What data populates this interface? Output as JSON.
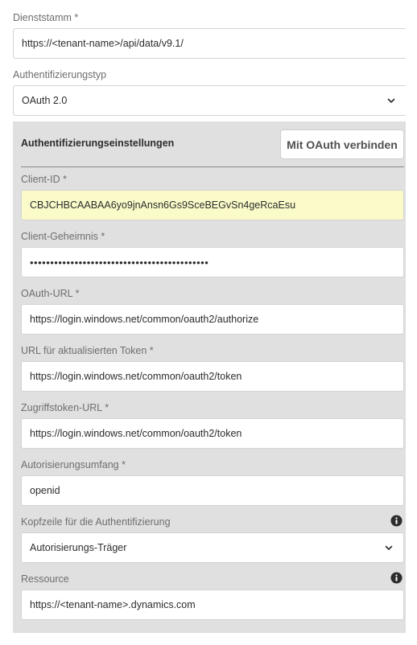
{
  "service_root": {
    "label": "Dienststamm *",
    "value": "https://<tenant-name>/api/data/v9.1/"
  },
  "auth_type": {
    "label": "Authentifizierungstyp",
    "selected": "OAuth 2.0"
  },
  "auth_settings": {
    "title": "Authentifizierungseinstellungen",
    "connect_button": "Mit OAuth verbinden",
    "client_id": {
      "label": "Client-ID *",
      "value": "CBJCHBCAABAA6yo9jnAnsn6Gs9SceBEGvSn4geRcaEsu"
    },
    "client_secret": {
      "label": "Client-Geheimnis *",
      "value": "••••••••••••••••••••••••••••••••••••••••••••"
    },
    "oauth_url": {
      "label": "OAuth-URL *",
      "value": "https://login.windows.net/common/oauth2/authorize"
    },
    "refresh_token_url": {
      "label": "URL für aktualisierten Token *",
      "value": "https://login.windows.net/common/oauth2/token"
    },
    "access_token_url": {
      "label": "Zugriffstoken-URL *",
      "value": "https://login.windows.net/common/oauth2/token"
    },
    "scope": {
      "label": "Autorisierungsumfang *",
      "value": "openid"
    },
    "auth_header": {
      "label": "Kopfzeile für die Authentifizierung",
      "selected": "Autorisierungs-Träger"
    },
    "resource": {
      "label": "Ressource",
      "value": "https://<tenant-name>.dynamics.com"
    }
  },
  "colors": {
    "panel_bg": "#e0e0e0",
    "autofill_bg": "#fafbc9",
    "label": "#6e6e6e",
    "text": "#2c2c2c"
  },
  "icons": {
    "dropdown": "chevron-down-icon",
    "info": "info-icon"
  }
}
